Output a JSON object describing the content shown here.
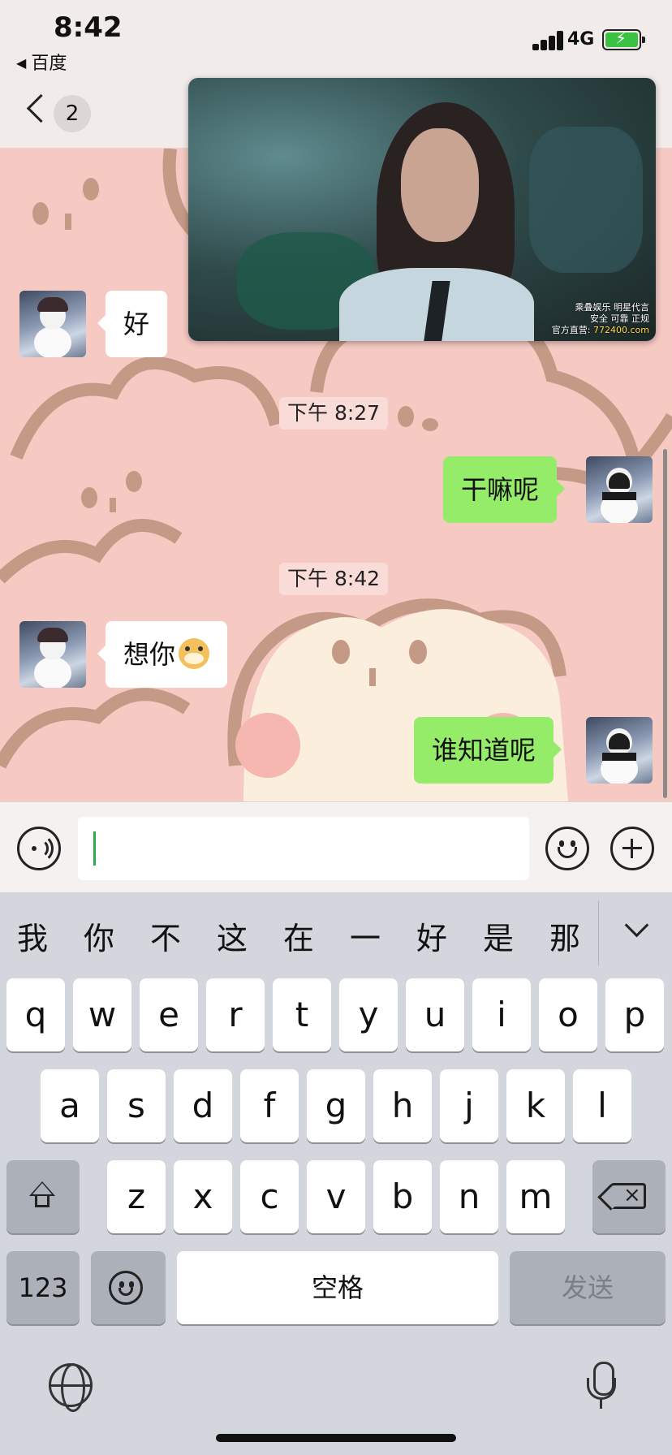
{
  "status_bar": {
    "time": "8:42",
    "back_app": "百度",
    "network": "4G",
    "battery_state": "charging",
    "battery_color": "#3dc145"
  },
  "header": {
    "unread_count": "2"
  },
  "video": {
    "watermark_line1": "乘叠娱乐 明星代言",
    "watermark_line2": "安全 可靠 正规",
    "watermark_prefix": "官方直营:",
    "watermark_url": "772400.com"
  },
  "messages": [
    {
      "direction": "in",
      "text": "好"
    },
    {
      "timestamp": "下午 8:27"
    },
    {
      "direction": "out",
      "text": "干嘛呢"
    },
    {
      "timestamp": "下午 8:42"
    },
    {
      "direction": "in",
      "text": "想你",
      "emoji": "dog-face-emoji"
    },
    {
      "direction": "out",
      "text": "谁知道呢"
    }
  ],
  "input_bar": {
    "value": "",
    "icons": [
      "voice-icon",
      "emoji-icon",
      "plus-icon"
    ]
  },
  "keyboard": {
    "candidates": [
      "我",
      "你",
      "不",
      "这",
      "在",
      "一",
      "好",
      "是",
      "那"
    ],
    "row1": [
      "q",
      "w",
      "e",
      "r",
      "t",
      "y",
      "u",
      "i",
      "o",
      "p"
    ],
    "row2": [
      "a",
      "s",
      "d",
      "f",
      "g",
      "h",
      "j",
      "k",
      "l"
    ],
    "row3": [
      "z",
      "x",
      "c",
      "v",
      "b",
      "n",
      "m"
    ],
    "num_label": "123",
    "space_label": "空格",
    "send_label": "发送",
    "icons": [
      "shift-icon",
      "backspace-icon",
      "emoji-icon",
      "globe-icon",
      "mic-icon",
      "chevron-down-icon"
    ]
  },
  "colors": {
    "chat_background": "#f6c9c3",
    "outgoing_bubble": "#95ec69",
    "incoming_bubble": "#ffffff",
    "keyboard_background": "#d3d6dc"
  }
}
